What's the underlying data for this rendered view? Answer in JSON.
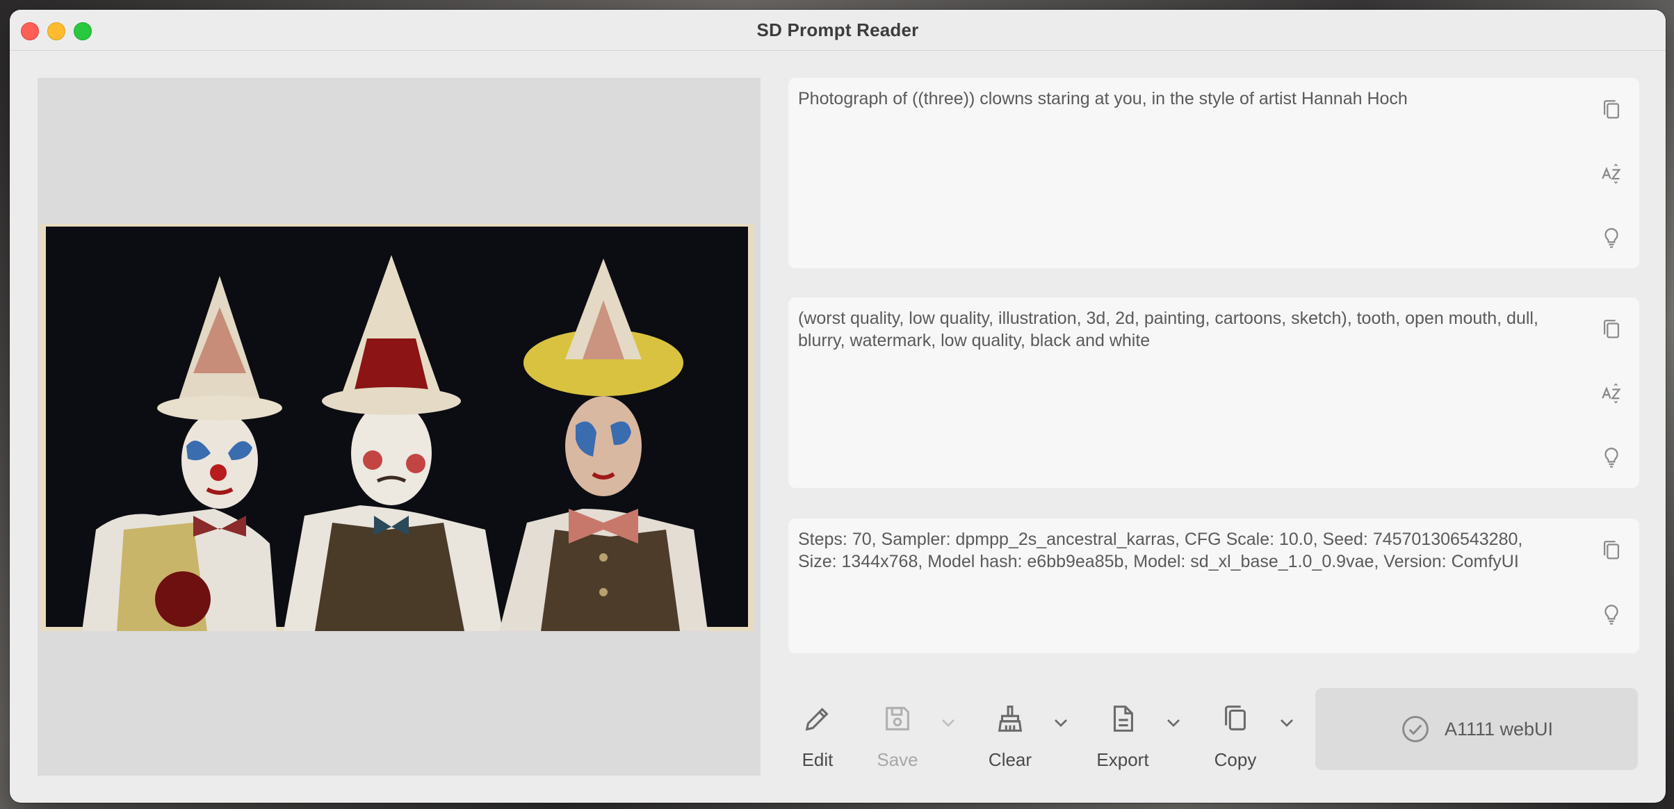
{
  "window": {
    "title": "SD Prompt Reader"
  },
  "prompts": {
    "positive": "Photograph of ((three)) clowns staring at you, in the style of artist Hannah Hoch",
    "negative": "(worst quality, low quality, illustration, 3d, 2d, painting, cartoons, sketch), tooth, open mouth, dull, blurry, watermark, low quality, black and white",
    "settings": "Steps: 70, Sampler: dpmpp_2s_ancestral_karras, CFG Scale: 10.0, Seed: 745701306543280, Size: 1344x768, Model hash: e6bb9ea85b, Model: sd_xl_base_1.0_0.9vae, Version: ComfyUI"
  },
  "textbox_icons": [
    "copy-icon",
    "sort-az-icon",
    "lightbulb-icon"
  ],
  "toolbar": {
    "edit_label": "Edit",
    "save_label": "Save",
    "clear_label": "Clear",
    "export_label": "Export",
    "copy_label": "Copy",
    "a1111_label": "A1111 webUI"
  },
  "colors": {
    "close": "#fe5f57",
    "minimize": "#febc2e",
    "maximize": "#28c840",
    "panel": "#f7f7f7",
    "window": "#ececec"
  }
}
